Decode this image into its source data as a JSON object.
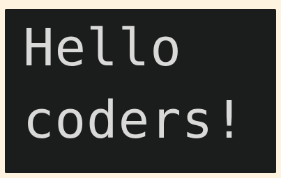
{
  "terminal": {
    "lines": [
      "Hello",
      "coders!"
    ],
    "colors": {
      "background": "#1b1c1c",
      "text": "#d9dad8",
      "frame": "#fdf3df"
    }
  }
}
